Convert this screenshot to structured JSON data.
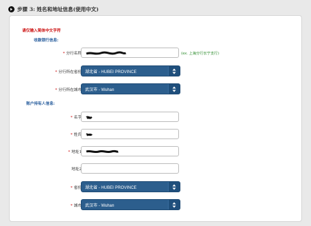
{
  "header": {
    "title": "步骤 3: 姓名和地址信息(使用中文)"
  },
  "warning": "请仅输入简体中文字符",
  "bank_section": {
    "title": "收款银行信息:",
    "branch_name": {
      "label": "分行名称:",
      "value": "",
      "hint": "(ex. 上海分行长宁支行)"
    },
    "branch_province": {
      "label": "分行所在省份:",
      "value": "湖北省 - HUBEI PROVINCE"
    },
    "branch_city": {
      "label": "分行所在城市:",
      "value": "武汉市 - Wuhan"
    }
  },
  "holder_section": {
    "title": "账户持有人信息:",
    "first_name": {
      "label": "名字:",
      "value": ""
    },
    "last_name": {
      "label": "姓氏:",
      "value": ""
    },
    "address1": {
      "label": "地址1:",
      "value": ""
    },
    "address2": {
      "label": "地址2:",
      "value": ""
    },
    "province": {
      "label": "省份:",
      "value": "湖北省 - HUBEI PROVINCE"
    },
    "city": {
      "label": "城市:",
      "value": "武汉市 - Wuhan"
    }
  },
  "icons": {
    "header": "circle-arrow-right-icon",
    "dropdown": "updown-arrows-icon"
  },
  "colors": {
    "accent": "#2c5e8d",
    "required": "#cc1111",
    "section_title": "#2a5f9e",
    "hint": "#2a8a2a"
  }
}
